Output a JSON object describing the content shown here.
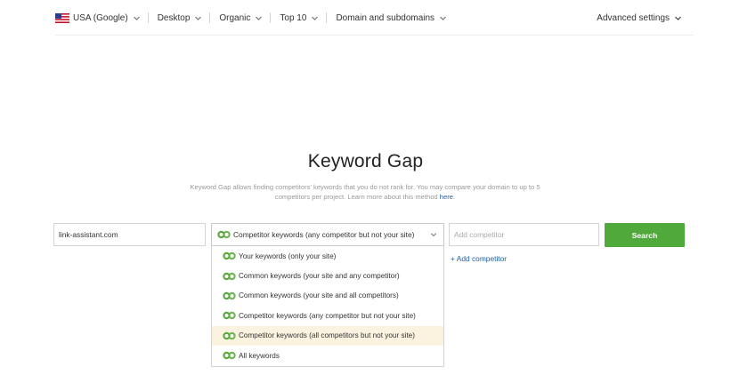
{
  "topbar": {
    "filters": [
      {
        "label": "USA (Google)"
      },
      {
        "label": "Desktop"
      },
      {
        "label": "Organic"
      },
      {
        "label": "Top 10"
      },
      {
        "label": "Domain and subdomains"
      }
    ],
    "advanced_label": "Advanced settings"
  },
  "main": {
    "title": "Keyword Gap",
    "description_part1": "Keyword Gap allows finding competitors' keywords that you do not rank for. You may compare your domain to up to 5 competitors per project. Learn more about this method ",
    "description_link": "here",
    "description_end": "."
  },
  "form": {
    "domain_value": "link-assistant.com",
    "selected_option": "Competitor keywords (any competitor but not your site)",
    "competitor_placeholder": "Add competitor",
    "search_label": "Search",
    "add_competitor_label": "+ Add competitor"
  },
  "dropdown": {
    "options": [
      {
        "label": "Your keywords (only your site)"
      },
      {
        "label": "Common keywords (your site and any competitor)"
      },
      {
        "label": "Common keywords (your site and all competitors)"
      },
      {
        "label": "Competitor keywords (any competitor but not your site)"
      },
      {
        "label": "Competitor keywords (all competitors but not your site)",
        "highlighted": true
      },
      {
        "label": "All keywords"
      }
    ]
  },
  "colors": {
    "accent_green": "#4fa93b",
    "link_blue": "#1f5fa8",
    "highlight": "#fbf3e0"
  }
}
